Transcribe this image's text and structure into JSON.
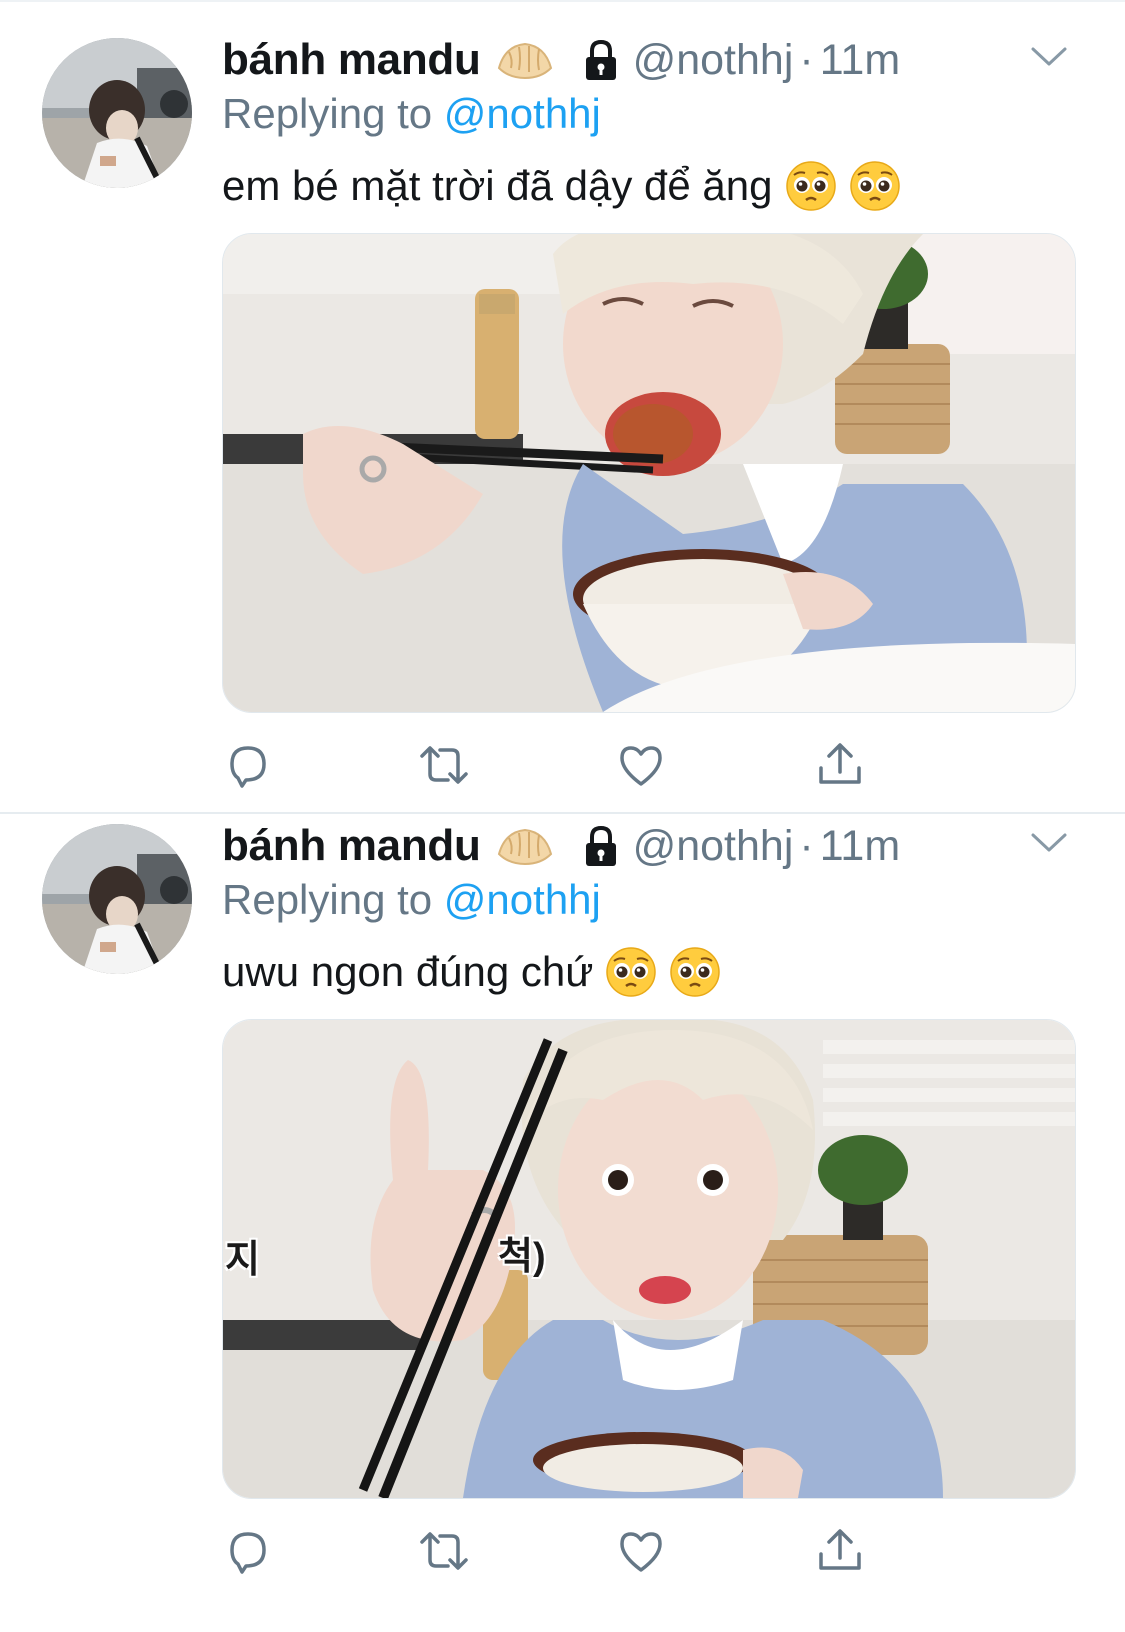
{
  "tweets": [
    {
      "display_name": "bánh mandu",
      "name_emoji": "dumpling",
      "protected_icon": "lock-icon",
      "handle": "@nothhj",
      "separator": "·",
      "time": "11m",
      "reply_prefix": "Replying to",
      "reply_to": "@nothhj",
      "text": "em bé mặt trời đã dậy để ăng",
      "text_emojis": [
        "pleading-face",
        "pleading-face"
      ],
      "media_alt_icon": "photo",
      "actions": [
        "reply-icon",
        "retweet-icon",
        "like-icon",
        "share-icon"
      ]
    },
    {
      "display_name": "bánh mandu",
      "name_emoji": "dumpling",
      "protected_icon": "lock-icon",
      "handle": "@nothhj",
      "separator": "·",
      "time": "11m",
      "reply_prefix": "Replying to",
      "reply_to": "@nothhj",
      "text": "uwu ngon đúng chứ",
      "text_emojis": [
        "pleading-face",
        "pleading-face"
      ],
      "media_caption_left": "지",
      "media_caption_right": "척)",
      "actions": [
        "reply-icon",
        "retweet-icon",
        "like-icon",
        "share-icon"
      ]
    }
  ],
  "colors": {
    "text": "#14171a",
    "secondary": "#657786",
    "link": "#1da1f2",
    "divider": "#e6ecf0"
  }
}
